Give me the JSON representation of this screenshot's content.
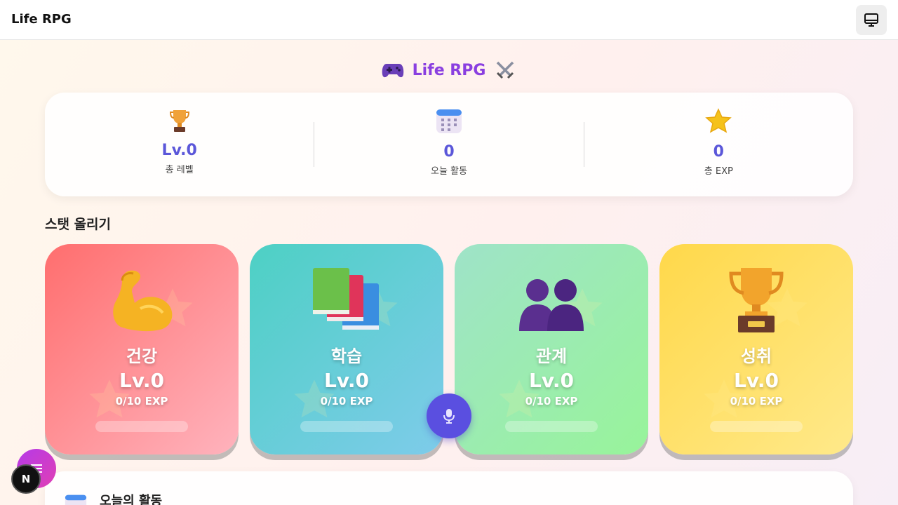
{
  "topbar": {
    "app_name": "Life RPG",
    "screen_icon": "monitor-icon"
  },
  "hero": {
    "title": "Life RPG",
    "left_icon": "gamepad-icon",
    "right_icon": "crossed-swords-icon",
    "title_color": "#8a3fe0"
  },
  "stats": [
    {
      "icon": "trophy-icon",
      "value": "Lv.0",
      "label": "총 레벨"
    },
    {
      "icon": "calendar-icon",
      "value": "0",
      "label": "오늘 활동"
    },
    {
      "icon": "star-icon",
      "value": "0",
      "label": "총 EXP"
    }
  ],
  "section": {
    "title": "스탯 올리기"
  },
  "cards": [
    {
      "icon": "flexed-arm-icon",
      "name": "건강",
      "level": "Lv.0",
      "exp": "0/10 EXP",
      "progress": 0
    },
    {
      "icon": "books-icon",
      "name": "학습",
      "level": "Lv.0",
      "exp": "0/10 EXP",
      "progress": 0
    },
    {
      "icon": "people-icon",
      "name": "관계",
      "level": "Lv.0",
      "exp": "0/10 EXP",
      "progress": 0
    },
    {
      "icon": "trophy-icon",
      "name": "성취",
      "level": "Lv.0",
      "exp": "0/10 EXP",
      "progress": 0
    }
  ],
  "floating": {
    "mic_icon": "microphone-icon",
    "menu_icon": "menu-icon",
    "badge_letter": "N"
  },
  "activity": {
    "title": "오늘의 활동",
    "icon": "calendar-icon"
  },
  "colors": {
    "accent": "#5b57d9",
    "mic": "#5a4fe0"
  }
}
